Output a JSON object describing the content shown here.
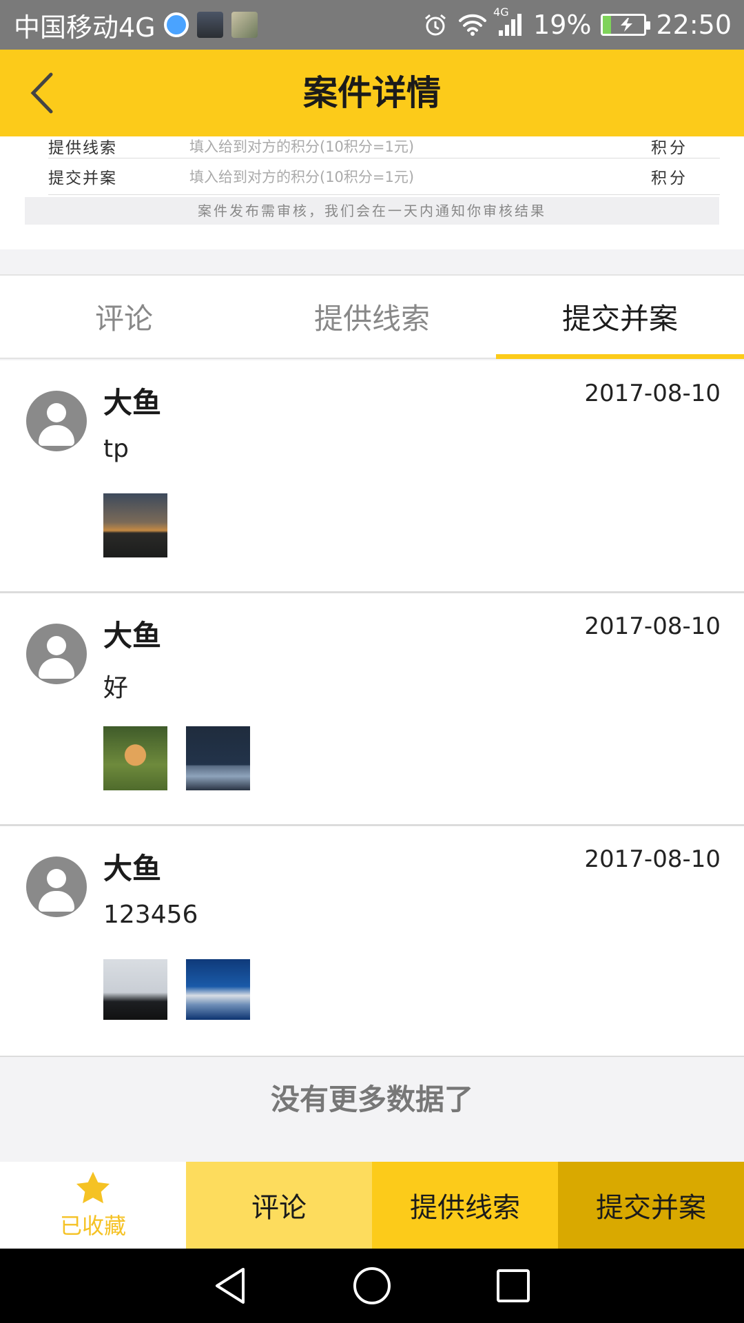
{
  "status_bar": {
    "carrier": "中国移动4G",
    "network": "4G",
    "battery": "19%",
    "battery_level": 0.19,
    "time": "22:50"
  },
  "header": {
    "title": "案件详情",
    "back_icon": "chevron-left-icon"
  },
  "form": {
    "rows": [
      {
        "label": "提供线索",
        "placeholder": "填入给到对方的积分(10积分=1元)",
        "unit": "积分"
      },
      {
        "label": "提交并案",
        "placeholder": "填入给到对方的积分(10积分=1元)",
        "unit": "积分"
      }
    ],
    "notice": "案件发布需审核，我们会在一天内通知你审核结果"
  },
  "tabs": [
    {
      "label": "评论",
      "active": false
    },
    {
      "label": "提供线索",
      "active": false
    },
    {
      "label": "提交并案",
      "active": true
    }
  ],
  "items": [
    {
      "user": "大鱼",
      "date": "2017-08-10",
      "text": "tp"
    },
    {
      "user": "大鱼",
      "date": "2017-08-10",
      "text": "好"
    },
    {
      "user": "大鱼",
      "date": "2017-08-10",
      "text": "123456"
    }
  ],
  "no_more": "没有更多数据了",
  "actions": {
    "favorite": "已收藏",
    "comment": "评论",
    "clue": "提供线索",
    "merge": "提交并案"
  },
  "colors": {
    "accent": "#fccb1a",
    "accent_light": "#fddc5d",
    "accent_dark": "#d9a900",
    "favorite": "#f5c224"
  }
}
